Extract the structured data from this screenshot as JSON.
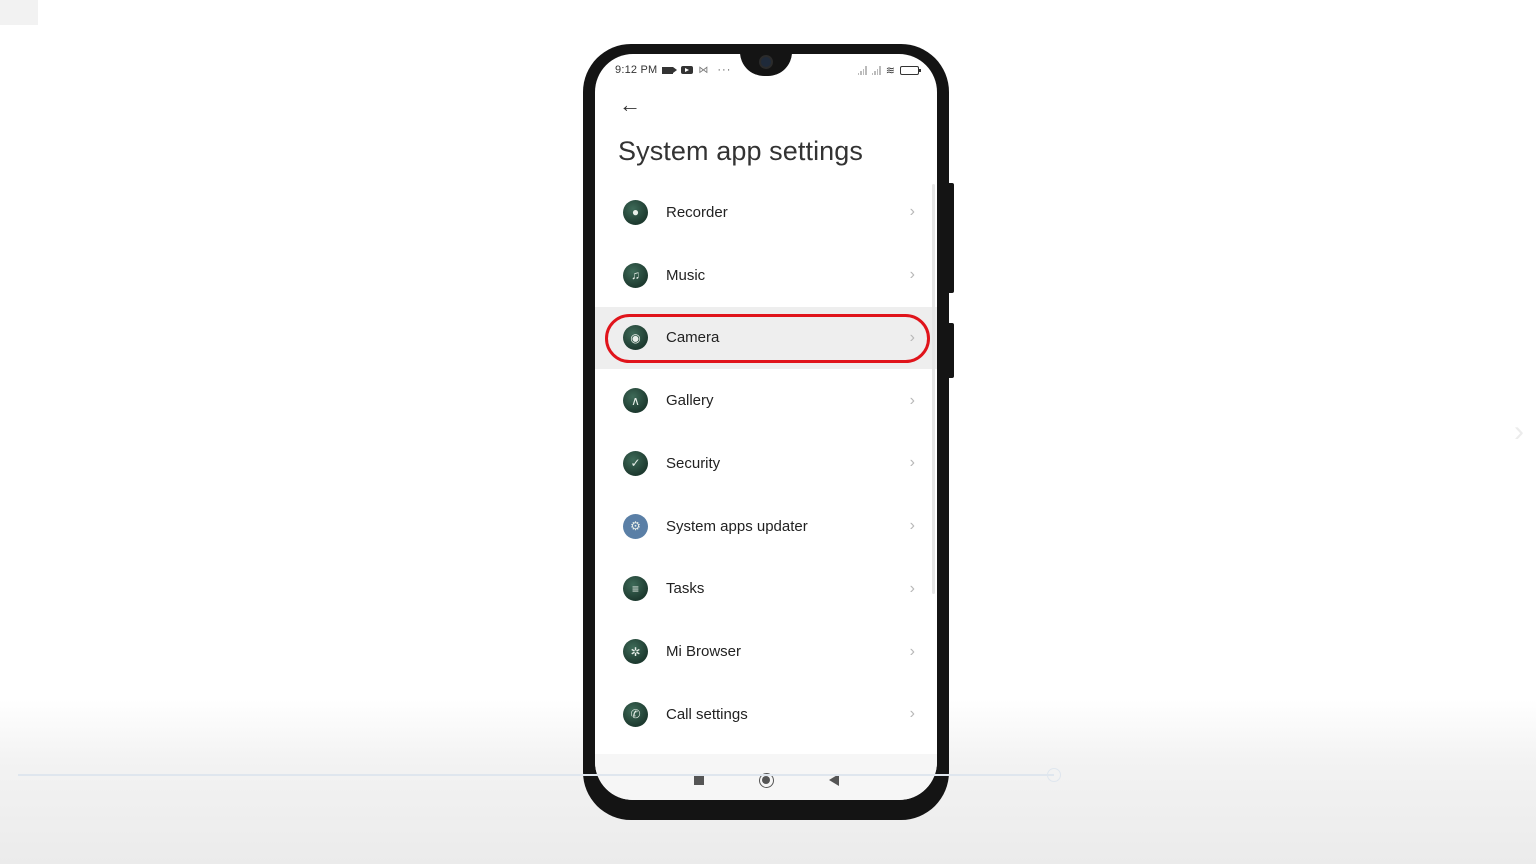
{
  "status_bar": {
    "time": "9:12 PM",
    "left_icons": [
      "video-camera-icon",
      "youtube-icon",
      "gmail-icon",
      "more-dots-icon"
    ],
    "more": "···",
    "right_icons": [
      "signal-1-icon",
      "signal-2-icon",
      "wifi-icon",
      "battery-icon"
    ]
  },
  "header": {
    "back_icon": "←",
    "title": "System app settings"
  },
  "list": {
    "chevron": "›",
    "items": [
      {
        "label": "Recorder",
        "icon": "microphone-icon",
        "glyph": "🎙"
      },
      {
        "label": "Music",
        "icon": "music-note-icon",
        "glyph": "♫"
      },
      {
        "label": "Camera",
        "icon": "camera-icon",
        "glyph": "◉",
        "selected": true
      },
      {
        "label": "Gallery",
        "icon": "mountain-image-icon",
        "glyph": "⛰"
      },
      {
        "label": "Security",
        "icon": "checkmark-shield-icon",
        "glyph": "✓"
      },
      {
        "label": "System apps updater",
        "icon": "gear-icon",
        "glyph": "⚙"
      },
      {
        "label": "Tasks",
        "icon": "list-lines-icon",
        "glyph": "≡"
      },
      {
        "label": "Mi Browser",
        "icon": "atom-browser-icon",
        "glyph": "✲"
      },
      {
        "label": "Call settings",
        "icon": "phone-handset-icon",
        "glyph": "✆"
      }
    ]
  },
  "highlight": {
    "target": "Camera",
    "color": "#e0141b"
  },
  "nav_bar": [
    "recent-apps-button",
    "home-button",
    "back-button"
  ],
  "overlay": {
    "next_chevron": "›"
  }
}
